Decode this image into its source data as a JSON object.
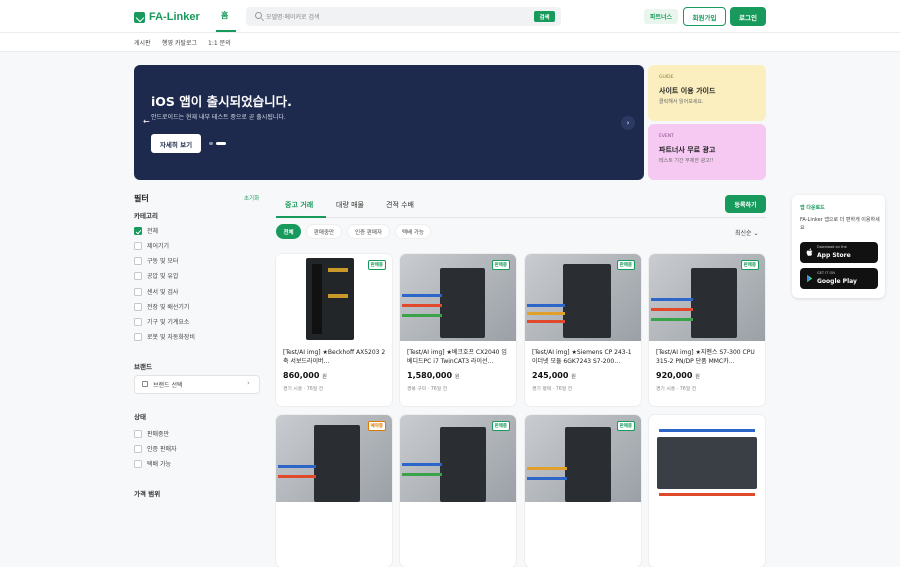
{
  "header": {
    "logo": "FA-Linker",
    "home_tab": "홈",
    "search_placeholder": "모델명·메이커로 검색",
    "search_button": "검색",
    "partner_button": "파트너스",
    "join_button": "회원가입",
    "login_button": "로그인"
  },
  "subnav": [
    "게시판",
    "행영 카탈로그",
    "1:1 문의"
  ],
  "hero": {
    "title": "iOS 앱이 출시되었습니다.",
    "subtitle": "안드로이드는 현재 내부 테스트 중으로 곧 출시됩니다.",
    "cta": "자세히 보기"
  },
  "promos": [
    {
      "tag": "GUIDE",
      "title": "사이트 이용 가이드",
      "sub": "클릭해서 읽어보세요.",
      "color": "#fbefc0"
    },
    {
      "tag": "EVENT",
      "title": "파트너사 무료 광고",
      "sub": "테스트 기간 무제한 광고!!",
      "color": "#f6c9f3"
    }
  ],
  "filter": {
    "title": "필터",
    "reset": "초기화",
    "category_title": "카테고리",
    "categories": [
      "전체",
      "제어기기",
      "구동 및 모터",
      "공압 및 유압",
      "센서 및 검사",
      "전장 및 배선기기",
      "기구 및 기계요소",
      "로봇 및 자동화장비"
    ],
    "brand_title": "브랜드",
    "brand_select": "브랜드 선택",
    "status_title": "상태",
    "statuses": [
      "판매중만",
      "인증 판매자",
      "택배 가능"
    ],
    "price_title": "가격 범위"
  },
  "main": {
    "tabs": [
      "중고 거래",
      "대량 매물",
      "견적 수배"
    ],
    "register": "등록하기",
    "chips": [
      "전체",
      "판매중만",
      "인증 판매자",
      "택배 가능"
    ],
    "sort": "최신순"
  },
  "products": [
    {
      "badge": "판매중",
      "title": "[Test/AI img] ★Beckhoff AX5203 2축 서보드라이버…",
      "price": "860,000",
      "unit": "원",
      "meta": "경기 시흥 · 76일 전"
    },
    {
      "badge": "판매중",
      "title": "[Test/AI img] ★베크호프 CX2040 임베디드PC i7 TwinCAT3 라이선…",
      "price": "1,580,000",
      "unit": "원",
      "meta": "경북 구미 · 76일 전"
    },
    {
      "badge": "판매중",
      "title": "[Test/AI img] ★Siemens CP 243-1 이더넷 모듈 6GK7243 S7-200…",
      "price": "245,000",
      "unit": "원",
      "meta": "경기 평택 · 76일 전"
    },
    {
      "badge": "판매중",
      "title": "[Test/AI img] ★지멘스 S7-300 CPU 315-2 PN/DP 단품 MMC카…",
      "price": "920,000",
      "unit": "원",
      "meta": "경기 시흥 · 76일 전"
    },
    {
      "badge": "예약중",
      "title": "",
      "price": "",
      "unit": "",
      "meta": ""
    },
    {
      "badge": "판매중",
      "title": "",
      "price": "",
      "unit": "",
      "meta": ""
    },
    {
      "badge": "판매중",
      "title": "",
      "price": "",
      "unit": "",
      "meta": ""
    },
    {
      "badge": "",
      "title": "",
      "price": "",
      "unit": "",
      "meta": ""
    }
  ],
  "app_download": {
    "title": "앱 다운로드",
    "desc": "FA-Linker 앱으로 더 편하게 이용하세요",
    "app_store_small": "Download on the",
    "app_store": "App Store",
    "play_small": "GET IT ON",
    "play": "Google Play"
  }
}
